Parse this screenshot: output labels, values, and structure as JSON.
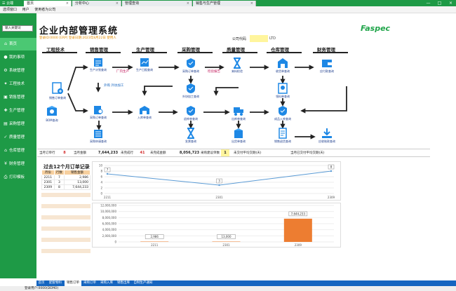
{
  "window": {
    "tabs": [
      {
        "label": "首页",
        "active": true
      },
      {
        "label": "分析中心"
      },
      {
        "label": "管理查询"
      },
      {
        "label": "销售与生产管理"
      }
    ],
    "controls": [
      "—",
      "□",
      "×"
    ]
  },
  "menu": {
    "items": [
      "选项窗口",
      "用户",
      "使用者为公司"
    ]
  },
  "sidebar": {
    "search_placeholder": "输入关键词",
    "items": [
      {
        "label": "首页",
        "icon": "home-icon"
      },
      {
        "label": "我的事项",
        "icon": "user-icon"
      },
      {
        "label": "系统管理",
        "icon": "gear-icon"
      },
      {
        "label": "工程技术",
        "icon": "tool-icon"
      },
      {
        "label": "销售管理",
        "icon": "cart-icon"
      },
      {
        "label": "生产管理",
        "icon": "factory-icon"
      },
      {
        "label": "采购管理",
        "icon": "bag-icon"
      },
      {
        "label": "质量管理",
        "icon": "check-icon"
      },
      {
        "label": "仓库管理",
        "icon": "warehouse-icon"
      },
      {
        "label": "财务管理",
        "icon": "money-icon"
      },
      {
        "label": "打印模板",
        "icon": "printer-icon"
      }
    ],
    "active_index": 0
  },
  "header": {
    "title": "企业内部管理系统",
    "status": "登录ID:0000 [ERP] 登录日期:2023年8月22日 使用人",
    "logo": "Faspec",
    "company_label": "公司代码",
    "company_code": "",
    "company_name": "LTD"
  },
  "flow": {
    "stages": [
      "工程技术",
      "销售管理",
      "生产管理",
      "采购管理",
      "质量管理",
      "仓库管理",
      "财务管理"
    ],
    "nodes": {
      "order_query": "销售订单查询",
      "bom_query": "BOM查询",
      "production_plan": "生产计划查询",
      "internal_production": "厂内生产",
      "production_daily": "生产日报查询",
      "po_query": "采购订单查询",
      "outsourcing_query": "外协加工查询",
      "incoming_inspect": "来料检验",
      "receipt_query": "收货单查询",
      "payment_query": "应付款查询",
      "purchase_order": "采购订单查询",
      "storage_query": "入库单查询",
      "material_issue": "领料单查询",
      "return_query": "退库单查询",
      "delivery_query": "出库单查询",
      "fg_receipt": "成品入库查询",
      "invoice_query": "发票查询",
      "receivable_query": "应收账款查询",
      "shipping_query": "出货单查询",
      "sales_return": "销售退货查询",
      "pending_purchase": "采购申请查询",
      "final_inventory": "库存明细查询",
      "qc_report": "检验报告",
      "outsourcing_note": "外购\n外协加工"
    }
  },
  "summary": {
    "items": [
      {
        "label": "当月订单行",
        "value": "8",
        "value_color": "#d32f2f"
      },
      {
        "label": "当月金额",
        "value": "7,644,233"
      },
      {
        "label": "未完成行",
        "value": "41",
        "value_color": "#d32f2f"
      },
      {
        "label": "未完成金额",
        "value": "8,056,723"
      },
      {
        "label": "采购建议单数",
        "value": "1",
        "highlight": true
      },
      {
        "label": "未交付平均交期(天)",
        "value": ""
      },
      {
        "label": "当月已交付平均交期(天)",
        "value": ""
      }
    ]
  },
  "records": {
    "title": "过去12个月订单记录",
    "headers": [
      "月份",
      "行数",
      "销售金额"
    ],
    "rows": [
      [
        "2211",
        "7",
        "2,986"
      ],
      [
        "2301",
        "3",
        "13,000"
      ],
      [
        "2309",
        "8",
        "7,644,233"
      ]
    ]
  },
  "chart_data": [
    {
      "type": "line",
      "categories": [
        "2211",
        "2301",
        "2309"
      ],
      "values": [
        7,
        3,
        8
      ],
      "ylim": [
        0,
        10
      ],
      "yticks": [
        0,
        2,
        4,
        6,
        8,
        10
      ],
      "color": "#5b9bd5",
      "data_labels": [
        "7",
        "3",
        "8"
      ]
    },
    {
      "type": "bar",
      "categories": [
        "2211",
        "2301",
        "2309"
      ],
      "values": [
        2986,
        13000,
        7644233
      ],
      "ylim": [
        0,
        12000000
      ],
      "yticks": [
        "0",
        "2,000,000",
        "4,000,000",
        "6,000,000",
        "8,000,000",
        "10,000,000",
        "12,000,000"
      ],
      "color": "#ed7d31",
      "data_labels": [
        "2,986",
        "13,000",
        "7,644,233"
      ]
    }
  ],
  "bottom_tabs": [
    "首页",
    "配套物料",
    "销售订单",
    "采购订单",
    "采购入库",
    "销售出库",
    "自制生产通知"
  ],
  "bottom_active": 2,
  "statusbar": {
    "text": "登录用户:0000(DEMO)"
  }
}
